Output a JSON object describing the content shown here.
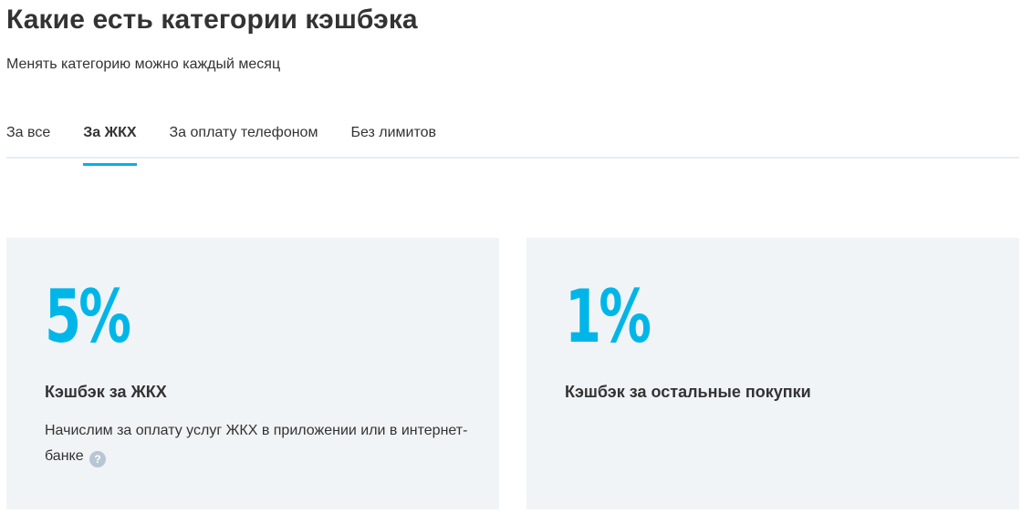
{
  "header": {
    "title": "Какие есть категории кэшбэка",
    "subtitle": "Менять категорию можно каждый месяц"
  },
  "tabs": [
    {
      "label": "За все",
      "active": false
    },
    {
      "label": "За ЖКХ",
      "active": true
    },
    {
      "label": "За оплату телефоном",
      "active": false
    },
    {
      "label": "Без лимитов",
      "active": false
    }
  ],
  "cards": [
    {
      "percent": "5%",
      "title": "Кэшбэк за ЖКХ",
      "description": "Начислим за оплату услуг ЖКХ в приложении или в интернет-банке",
      "help_icon": "question-mark",
      "help_glyph": "?"
    },
    {
      "percent": "1%",
      "title": "Кэшбэк за остальные покупки"
    }
  ],
  "colors": {
    "accent": "#00b6e8",
    "card_background": "#f1f4f7",
    "tab_underline": "#00b2e6",
    "divider": "#e6edf1"
  }
}
